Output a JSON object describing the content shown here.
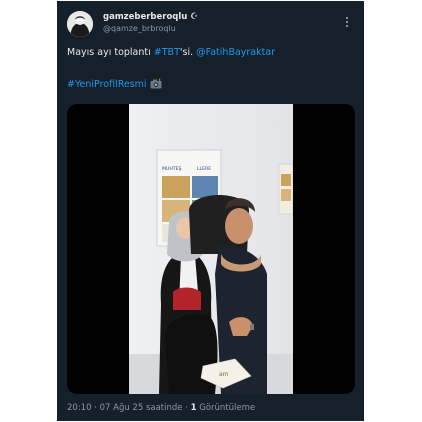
{
  "tweet": {
    "author": {
      "display_name": "gamzeberberoqlu ☪",
      "handle": "@qamze_brbroqlu"
    },
    "text": {
      "part1": "Mayıs ayı toplantı ",
      "hashtag_tbt": "#TBT",
      "part2": "'si.  ",
      "mention": "@FatihBayraktar",
      "hashtag_profile": "#YeniProfilResmi"
    },
    "media": {
      "poster_text_1": "MUHTEŞ",
      "poster_text_2": "LLERE"
    },
    "footer": {
      "time": "20:10",
      "separator": " · ",
      "date": "07 Ağu 25 saatinde",
      "views_count": "1",
      "views_label": " Görüntüleme"
    }
  },
  "colors": {
    "background": "#15202b",
    "text": "#e7e9ea",
    "secondary": "#8b98a5",
    "link": "#1d9bf0"
  },
  "icons": {
    "more": "more-options-icon",
    "emoji": "camera-with-flash-emoji-icon",
    "avatar": "avatar"
  }
}
